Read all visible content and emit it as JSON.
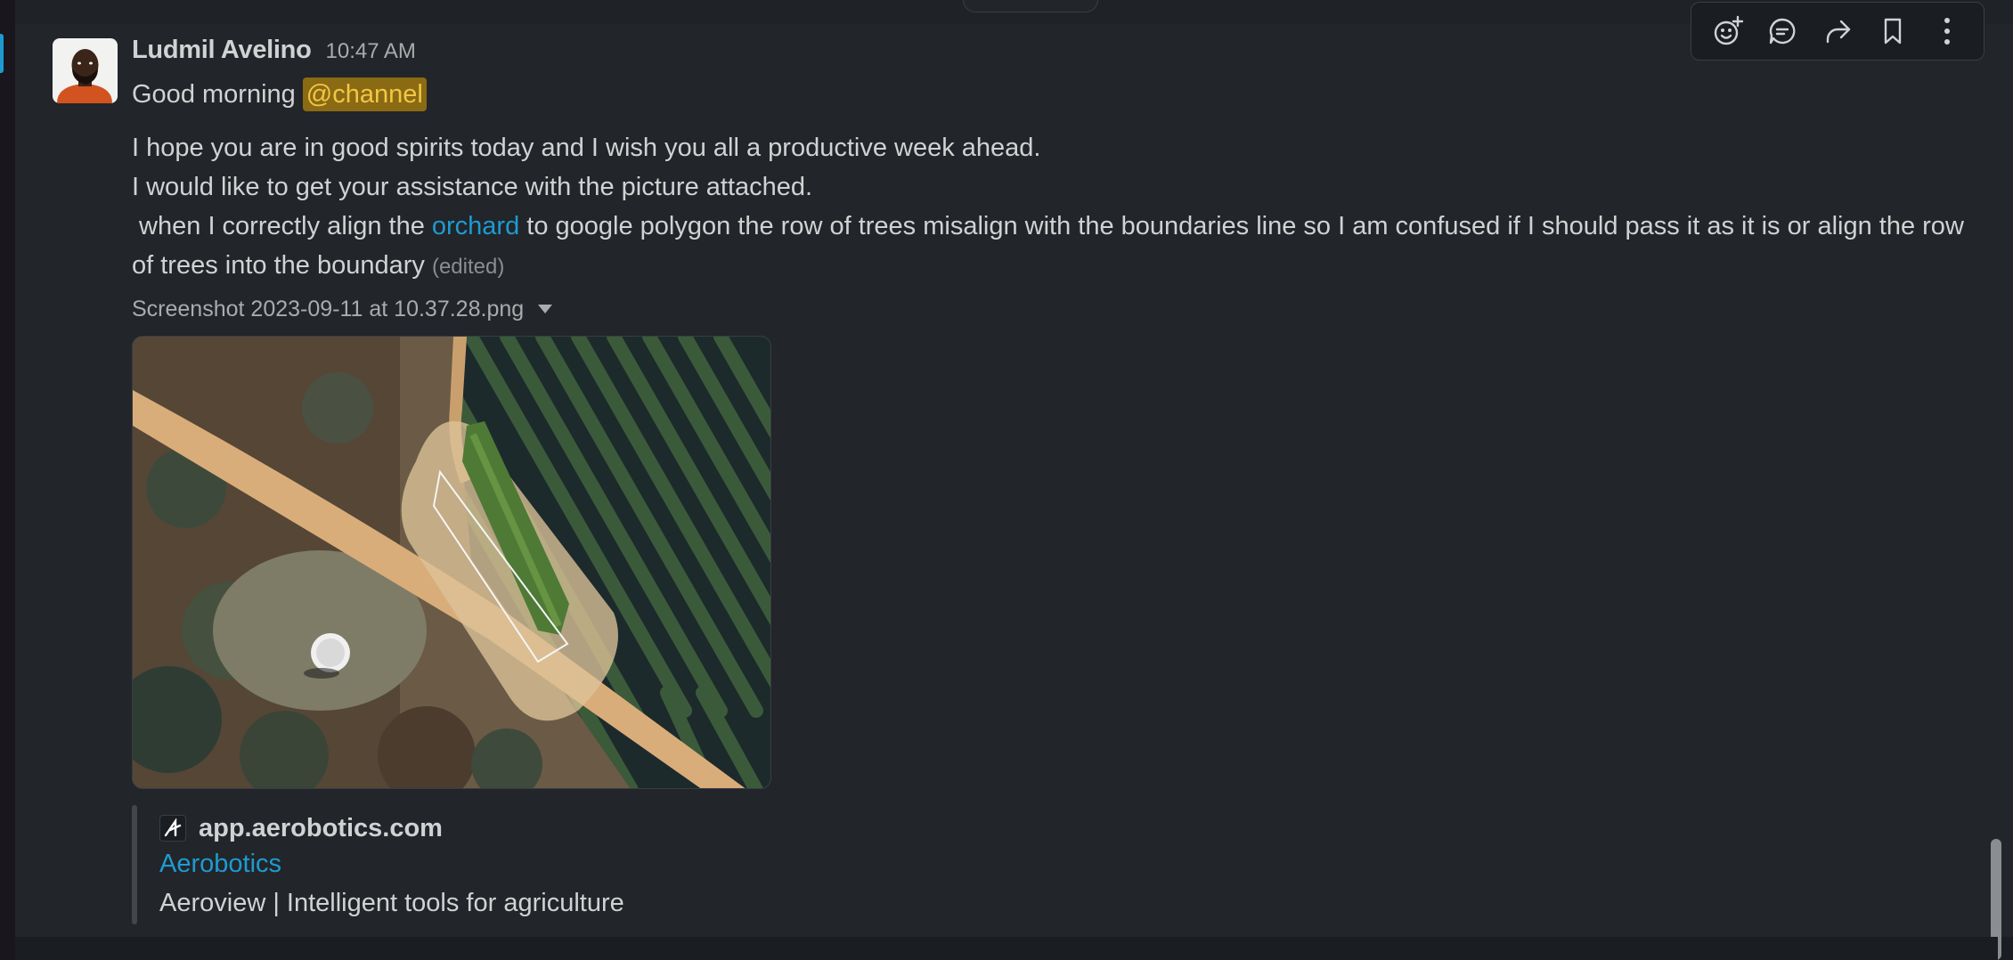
{
  "message": {
    "author": "Ludmil Avelino",
    "timestamp": "10:47 AM",
    "greeting": "Good morning",
    "mention": "@channel",
    "line1": "I hope you are in good spirits today and I wish you all a productive week ahead.",
    "line2": "I would like to get your assistance with the picture attached.",
    "line3_start": " when I correctly align the ",
    "line3_link": "orchard",
    "line3_end": " to google polygon the row of trees misalign with the boundaries line so I am confused if I should pass it as it is or align the row of trees into the boundary",
    "edited": "(edited)"
  },
  "attachment": {
    "filename": "Screenshot 2023-09-11 at 10.37.28.png"
  },
  "unfurl": {
    "site": "app.aerobotics.com",
    "title": "Aerobotics",
    "description": "Aeroview | Intelligent tools for agriculture"
  },
  "toolbar": {
    "icons": [
      "add-reaction-icon",
      "reply-in-thread-icon",
      "share-icon",
      "bookmark-icon",
      "more-actions-icon"
    ]
  },
  "colors": {
    "background": "#1a1d21",
    "pane": "#222529",
    "text": "#d1d2d3",
    "link": "#1d9bd1",
    "mention_bg": "#8a6a13",
    "mention_text": "#f2c744"
  }
}
